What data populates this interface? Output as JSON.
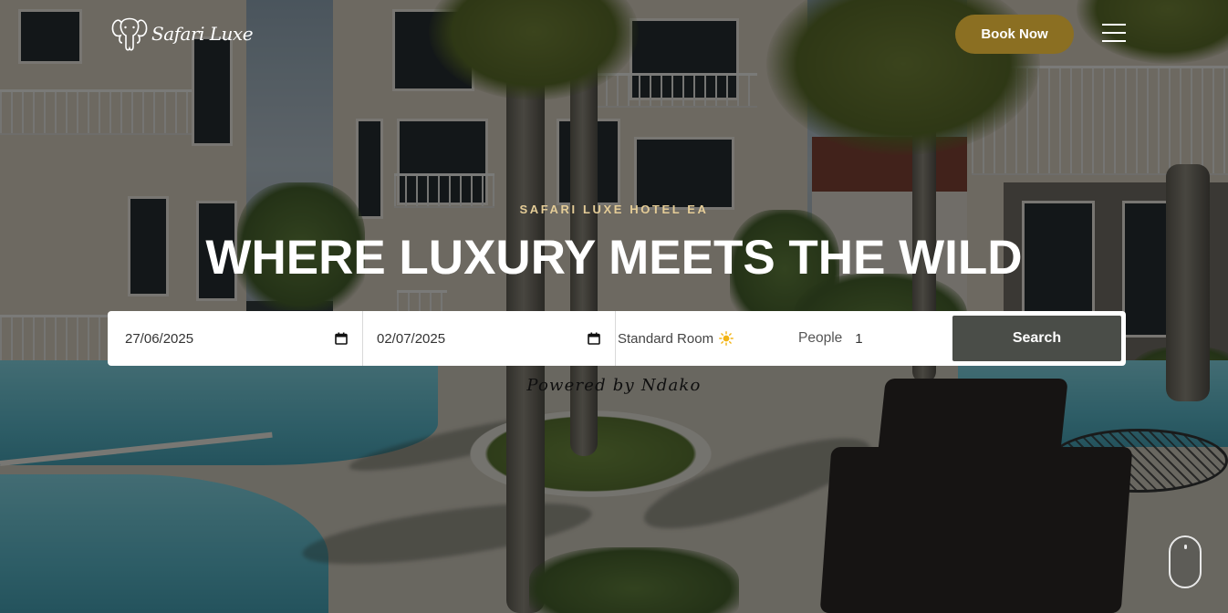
{
  "brand": {
    "name": "Safari Luxe",
    "logo_icon": "elephant-icon"
  },
  "header": {
    "book_label": "Book Now",
    "menu_icon": "hamburger-menu-icon"
  },
  "hero": {
    "eyebrow": "SAFARI LUXE HOTEL EA",
    "headline": "WHERE LUXURY MEETS THE WILD"
  },
  "booking": {
    "check_in": "27/06/2025",
    "check_out": "02/07/2025",
    "room_type": "Standard Room",
    "room_icon": "sun-icon",
    "people_label": "People",
    "people_value": "1",
    "search_label": "Search"
  },
  "powered_by": "Powered by Ndako",
  "colors": {
    "accent_gold": "#8b6f22",
    "eyebrow_gold": "#e4cc97",
    "search_button": "#4a4d48"
  }
}
